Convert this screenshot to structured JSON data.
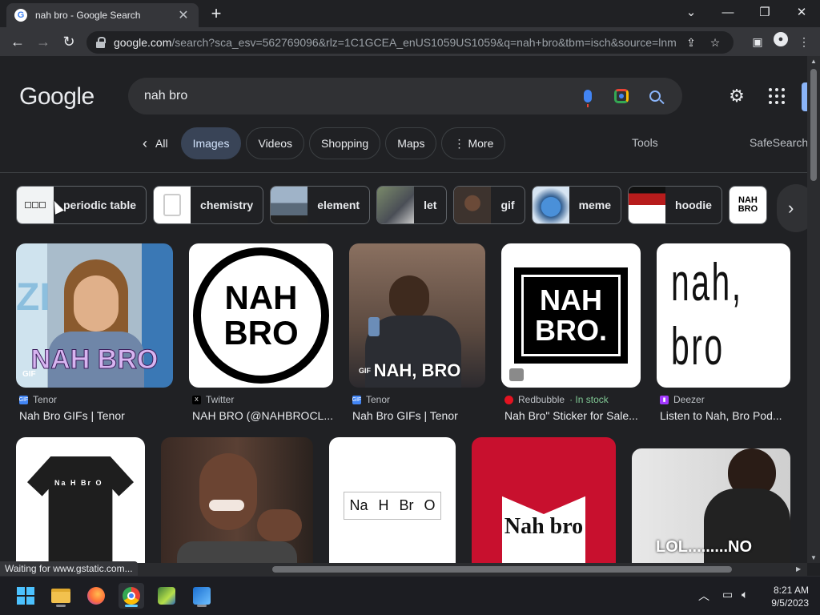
{
  "tab": {
    "title": "nah bro - Google Search",
    "favicon": "G"
  },
  "window_controls": {
    "dropdown": "⌄",
    "minimize": "—",
    "restore": "❐",
    "close": "✕"
  },
  "address_bar": {
    "domain": "google.com",
    "path": "/search?sca_esv=562769096&rlz=1C1GCEA_enUS1059US1059&q=nah+bro&tbm=isch&source=lnm..."
  },
  "logo": "Google",
  "search": {
    "query": "nah bro"
  },
  "filters": [
    {
      "label": "All",
      "prefix": "‹"
    },
    {
      "label": "Images",
      "active": true
    },
    {
      "label": "Videos"
    },
    {
      "label": "Shopping"
    },
    {
      "label": "Maps"
    },
    {
      "label": "More",
      "prefix": "⋮"
    }
  ],
  "tools_label": "Tools",
  "safesearch_label": "SafeSearch",
  "related": [
    {
      "label": "periodic table",
      "thumb": "#f1f3f4"
    },
    {
      "label": "chemistry",
      "thumb": "#ffffff"
    },
    {
      "label": "element",
      "thumb": "#5a6a7a"
    },
    {
      "label": "let",
      "thumb": "#4a4e56"
    },
    {
      "label": "gif",
      "thumb": "#3d332e"
    },
    {
      "label": "meme",
      "thumb": "#2f5c8f"
    },
    {
      "label": "hoodie",
      "thumb": "#b71c1c"
    },
    {
      "label": "NAH BRO",
      "thumb": "#ffffff"
    }
  ],
  "results_row1": [
    {
      "source": "Tenor",
      "title": "Nah Bro GIFs | Tenor",
      "caption": "NAH BRO",
      "src_color": "#4285f4",
      "src_glyph": "GIF"
    },
    {
      "source": "Twitter",
      "title": "NAH BRO (@NAHBROCL...",
      "caption": "NAH BRO",
      "src_color": "#000000",
      "src_glyph": "X"
    },
    {
      "source": "Tenor",
      "title": "Nah Bro GIFs | Tenor",
      "caption": "NAH, BRO",
      "src_color": "#4285f4",
      "src_glyph": "GIF"
    },
    {
      "source": "Redbubble",
      "stock": " · In stock",
      "title": "Nah Bro\" Sticker for Sale...",
      "caption": "NAH BRO.",
      "src_color": "#e41321",
      "src_glyph": "●"
    },
    {
      "source": "Deezer",
      "title": "Listen to Nah, Bro Pod...",
      "caption": "nah, bro",
      "src_color": "#a238ff",
      "src_glyph": "▮"
    }
  ],
  "results_row2": [
    {
      "caption": "Na H Br O"
    },
    {
      "caption": ""
    },
    {
      "caption": "Na H Br O"
    },
    {
      "caption": "Nah bro"
    },
    {
      "caption": "LOL.........NO"
    }
  ],
  "status_text": "Waiting for www.gstatic.com...",
  "clock": {
    "time": "8:21 AM",
    "date": "9/5/2023"
  }
}
